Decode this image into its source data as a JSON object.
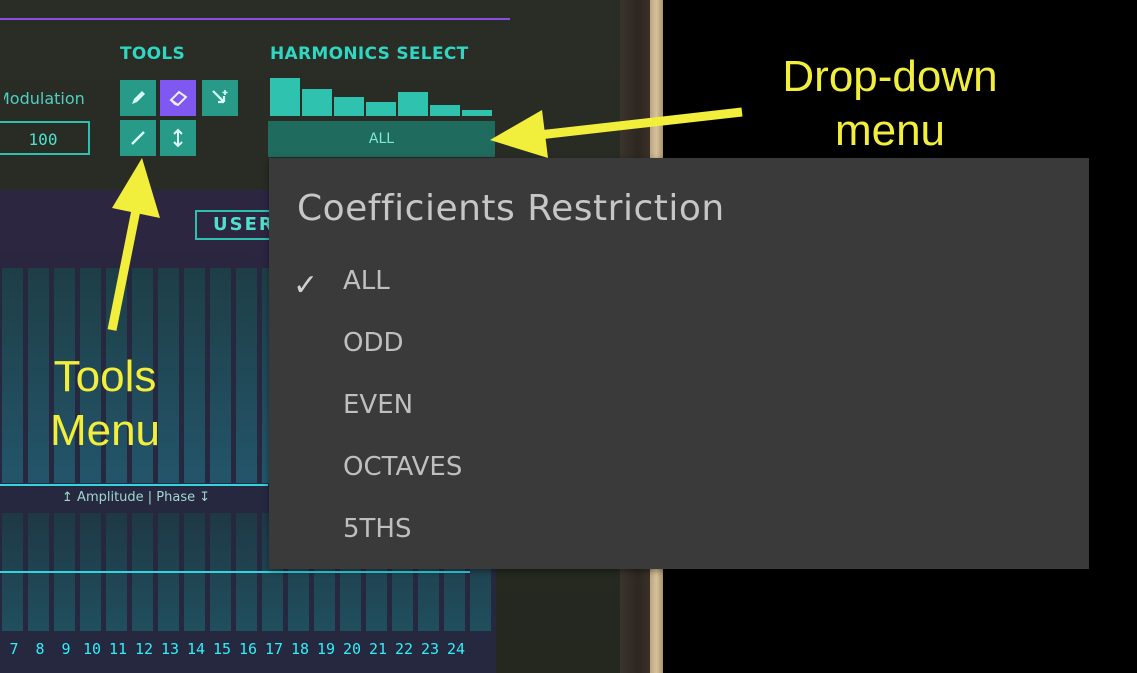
{
  "plugin": {
    "modulation_label": "Modulation",
    "modulation_value": "100",
    "tools_label": "TOOLS",
    "harmonics_label": "HARMONICS SELECT",
    "harmonics_dropdown_value": "ALL",
    "user_button_label": "USER",
    "amp_phase_label": "Amplitude | Phase",
    "harmonic_numbers": [
      "7",
      "8",
      "9",
      "10",
      "11",
      "12",
      "13",
      "14",
      "15",
      "16",
      "17",
      "18",
      "19",
      "20",
      "21",
      "22",
      "23",
      "24"
    ],
    "tools": [
      "pencil-icon",
      "eraser-icon",
      "arrow-in-icon",
      "line-icon",
      "vertical-arrows-icon"
    ],
    "harmonics_bar_levels": [
      1.0,
      0.7,
      0.5,
      0.38,
      0.62,
      0.3,
      0.16
    ]
  },
  "menu": {
    "title": "Coefficients Restriction",
    "items": [
      {
        "label": "ALL",
        "checked": true
      },
      {
        "label": "ODD",
        "checked": false
      },
      {
        "label": "EVEN",
        "checked": false
      },
      {
        "label": "OCTAVES",
        "checked": false
      },
      {
        "label": "5THS",
        "checked": false
      }
    ]
  },
  "annotations": {
    "dropdown_line1": "Drop-down",
    "dropdown_line2": "menu",
    "tools_line1": "Tools",
    "tools_line2": "Menu"
  },
  "colors": {
    "accent_teal": "#2fd6c2",
    "accent_purple": "#7e58f0",
    "annotation_yellow": "#f2ee3c",
    "menu_bg": "#3a3a3a"
  }
}
